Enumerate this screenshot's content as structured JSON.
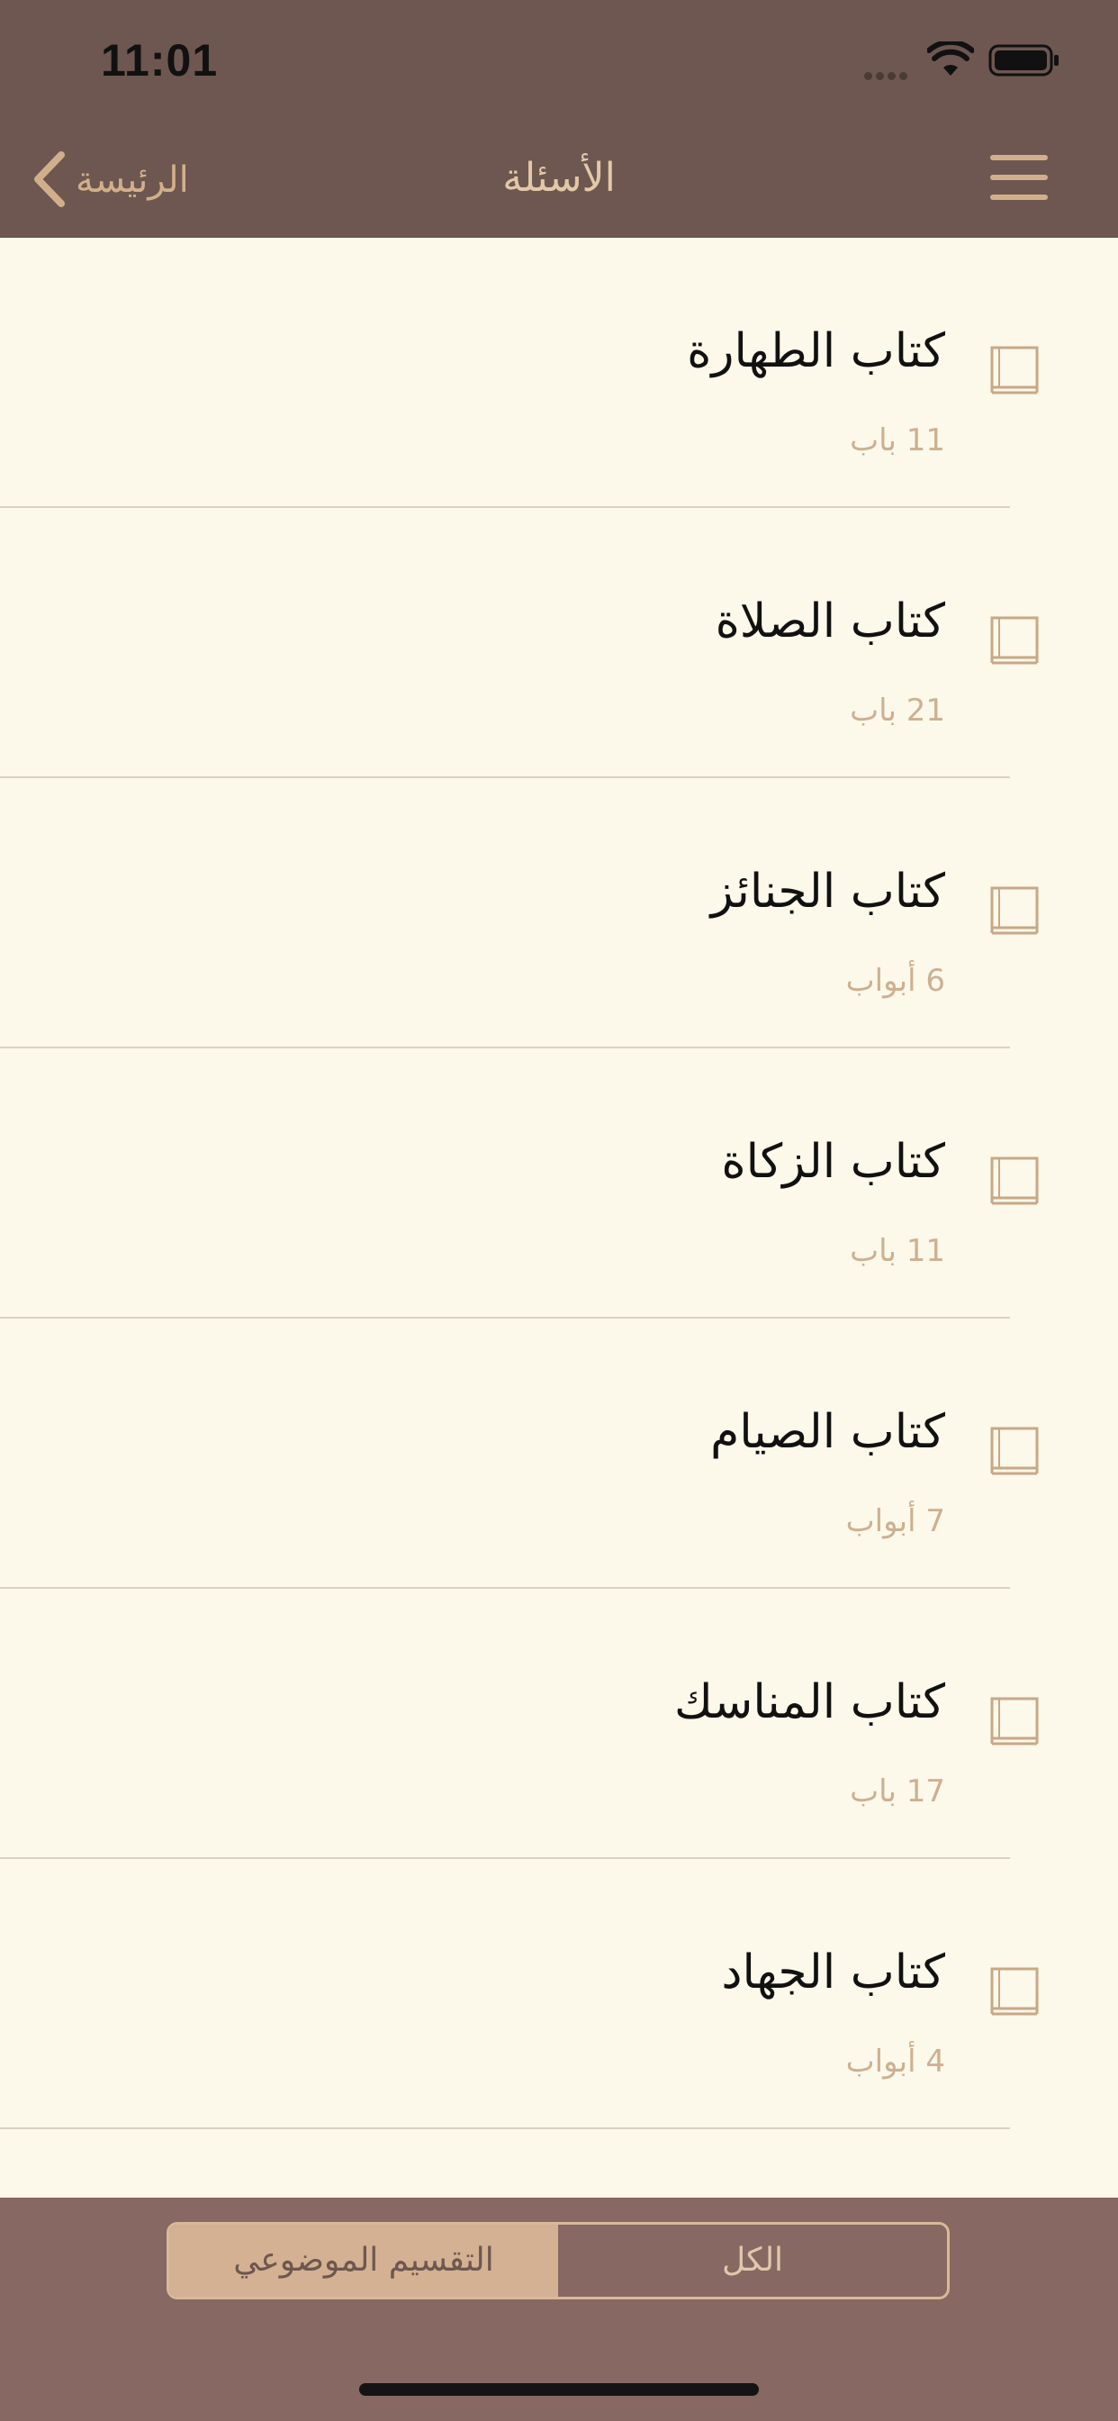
{
  "status_bar": {
    "time": "11:01"
  },
  "nav": {
    "title": "الأسئلة",
    "back_label": "الرئيسة"
  },
  "books": [
    {
      "title": "كتاب الطهارة",
      "count": "11 باب"
    },
    {
      "title": "كتاب الصلاة",
      "count": "21 باب"
    },
    {
      "title": "كتاب الجنائز",
      "count": "6 أبواب"
    },
    {
      "title": "كتاب الزكاة",
      "count": "11 باب"
    },
    {
      "title": "كتاب الصيام",
      "count": "7 أبواب"
    },
    {
      "title": "كتاب المناسك",
      "count": "17 باب"
    },
    {
      "title": "كتاب الجهاد",
      "count": "4 أبواب"
    }
  ],
  "segments": {
    "left_label": "التقسيم الموضوعي",
    "right_label": "الكل",
    "selected": "التقسيم الموضوعي"
  },
  "colors": {
    "header_bg": "#6D5750",
    "page_bg": "#FCF8EA",
    "accent": "#D2AF8C",
    "bottom_bg": "#876862"
  },
  "icons": {
    "menu": "hamburger-icon",
    "back": "chevron-left-icon",
    "item": "book-icon",
    "wifi": "wifi-icon",
    "battery": "battery-icon"
  }
}
